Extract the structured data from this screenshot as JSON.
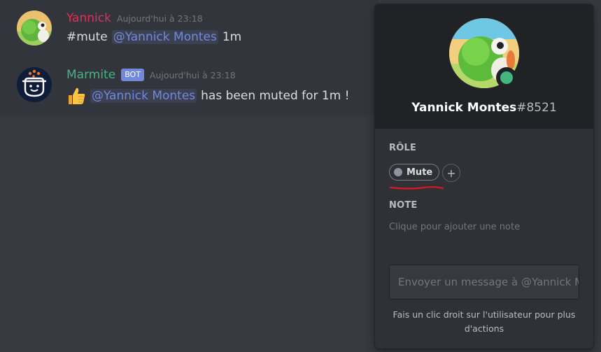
{
  "messages": [
    {
      "username": "Yannick",
      "username_color": "#e32e59",
      "timestamp": "Aujourd'hui à 23:18",
      "text_before": "#mute",
      "mention": "@Yannick Montes",
      "text_after": "1m"
    },
    {
      "username": "Marmite",
      "username_color": "#43b581",
      "bot_tag": "BOT",
      "timestamp": "Aujourd'hui à 23:18",
      "icon": "thumbs-up-icon",
      "mention": "@Yannick Montes",
      "text_after": "has been muted for 1m !"
    }
  ],
  "profile": {
    "name": "Yannick Montes",
    "discriminator": "#8521",
    "status": "online",
    "status_color": "#43b581",
    "role_label": "RÔLE",
    "roles": [
      {
        "name": "Mute",
        "color": "#8d949b"
      }
    ],
    "note_label": "NOTE",
    "note_placeholder": "Clique pour ajouter une note",
    "message_placeholder": "Envoyer un message à @Yannick Montes",
    "hint": "Fais un clic droit sur l'utilisateur pour plus d'actions"
  },
  "colors": {
    "background": "#36393f",
    "popout": "#2f3136",
    "popout_header": "#202225",
    "mention": "#7289da",
    "annotation_underline": "#e3141c"
  }
}
